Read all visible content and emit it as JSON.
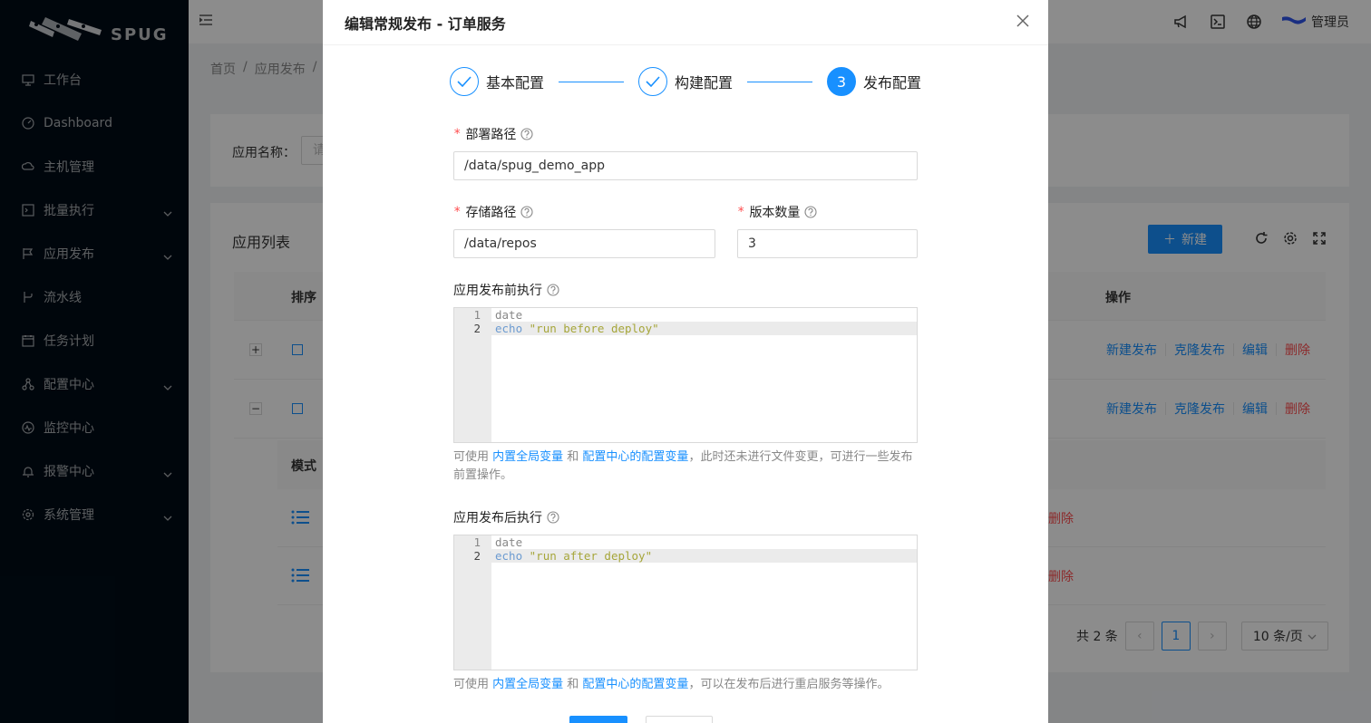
{
  "sidebar": {
    "logo_text": "SPUG",
    "items": [
      {
        "label": "工作台",
        "icon": "desktop-icon",
        "chevron": false
      },
      {
        "label": "Dashboard",
        "icon": "dashboard-icon",
        "chevron": false
      },
      {
        "label": "主机管理",
        "icon": "cloud-server-icon",
        "chevron": false
      },
      {
        "label": "批量执行",
        "icon": "code-icon",
        "chevron": true
      },
      {
        "label": "应用发布",
        "icon": "flag-icon",
        "chevron": true
      },
      {
        "label": "流水线",
        "icon": "branch-icon",
        "chevron": false
      },
      {
        "label": "任务计划",
        "icon": "schedule-icon",
        "chevron": false
      },
      {
        "label": "配置中心",
        "icon": "deployment-unit-icon",
        "chevron": true
      },
      {
        "label": "监控中心",
        "icon": "monitor-icon",
        "chevron": false
      },
      {
        "label": "报警中心",
        "icon": "alert-icon",
        "chevron": true
      },
      {
        "label": "系统管理",
        "icon": "setting-icon",
        "chevron": true
      }
    ]
  },
  "header": {
    "user_name": "管理员"
  },
  "breadcrumb": {
    "items": [
      "首页",
      "/",
      "应用发布",
      "/"
    ]
  },
  "search": {
    "label": "应用名称：",
    "placeholder": "请"
  },
  "app_list": {
    "title": "应用列表",
    "new_button": "新建",
    "columns": {
      "sort": "排序",
      "ops": "操作"
    },
    "rows": [
      {
        "expand": "+",
        "ops": [
          "新建发布",
          "克隆发布",
          "编辑",
          "删除"
        ]
      },
      {
        "expand": "−",
        "ops": [
          "新建发布",
          "克隆发布",
          "编辑",
          "删除"
        ]
      }
    ],
    "sub_table": {
      "column": "模式",
      "rows": [
        {
          "op": "删除"
        },
        {
          "op": "删除"
        }
      ]
    },
    "pagination": {
      "total": "共 2 条",
      "current": "1",
      "page_size": "10 条/页"
    }
  },
  "modal": {
    "title": "编辑常规发布 - 订单服务",
    "steps": [
      {
        "label": "基本配置",
        "status": "done"
      },
      {
        "label": "构建配置",
        "status": "done"
      },
      {
        "label": "发布配置",
        "status": "active",
        "number": "3"
      }
    ],
    "deploy_path": {
      "label": "部署路径",
      "value": "/data/spug_demo_app"
    },
    "storage_path": {
      "label": "存储路径",
      "value": "/data/repos"
    },
    "version_count": {
      "label": "版本数量",
      "value": "3"
    },
    "pre_deploy": {
      "label": "应用发布前执行",
      "lines": [
        {
          "num": "1",
          "kw": "",
          "text": "date"
        },
        {
          "num": "2",
          "kw": "echo",
          "text": "\"run before deploy\""
        }
      ],
      "help_prefix": "可使用 ",
      "help_link1": "内置全局变量",
      "help_mid": " 和 ",
      "help_link2": "配置中心的配置变量",
      "help_suffix": "，此时还未进行文件变更，可进行一些发布前置操作。"
    },
    "post_deploy": {
      "label": "应用发布后执行",
      "lines": [
        {
          "num": "1",
          "kw": "",
          "text": "date"
        },
        {
          "num": "2",
          "kw": "echo",
          "text": "\"run after deploy\""
        }
      ],
      "help_prefix": "可使用 ",
      "help_link1": "内置全局变量",
      "help_mid": " 和 ",
      "help_link2": "配置中心的配置变量",
      "help_suffix": "，可以在发布后进行重启服务等操作。"
    }
  },
  "colors": {
    "primary": "#1890ff",
    "danger": "#ff4d4f",
    "sidebar_bg": "#000c17"
  }
}
